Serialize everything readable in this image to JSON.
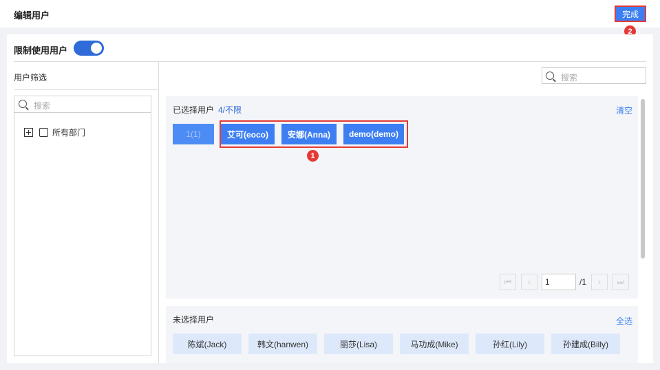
{
  "header": {
    "title": "编辑用户",
    "done_label": "完成",
    "badge_done": "2"
  },
  "restrict": {
    "label": "限制使用用户",
    "enabled": true
  },
  "filter": {
    "title": "用户筛选",
    "search_placeholder": "搜索",
    "tree_root": "所有部门"
  },
  "right": {
    "search_placeholder": "搜索"
  },
  "selected": {
    "title": "已选择用户",
    "count": "4/不限",
    "clear_label": "清空",
    "first_chip": "1(1)",
    "users": [
      "艾可(eoco)",
      "安娜(Anna)",
      "demo(demo)"
    ],
    "badge": "1"
  },
  "pager": {
    "page": "1",
    "total": "/1"
  },
  "unselected": {
    "title": "未选择用户",
    "select_all_label": "全选",
    "users": [
      "陈斌(Jack)",
      "韩文(hanwen)",
      "丽莎(Lisa)",
      "马功成(Mike)",
      "孙红(Lily)",
      "孙建成(Billy)"
    ]
  },
  "colors": {
    "accent": "#3d7ff2",
    "highlight": "#e53935",
    "toggle": "#2f6bd9"
  }
}
